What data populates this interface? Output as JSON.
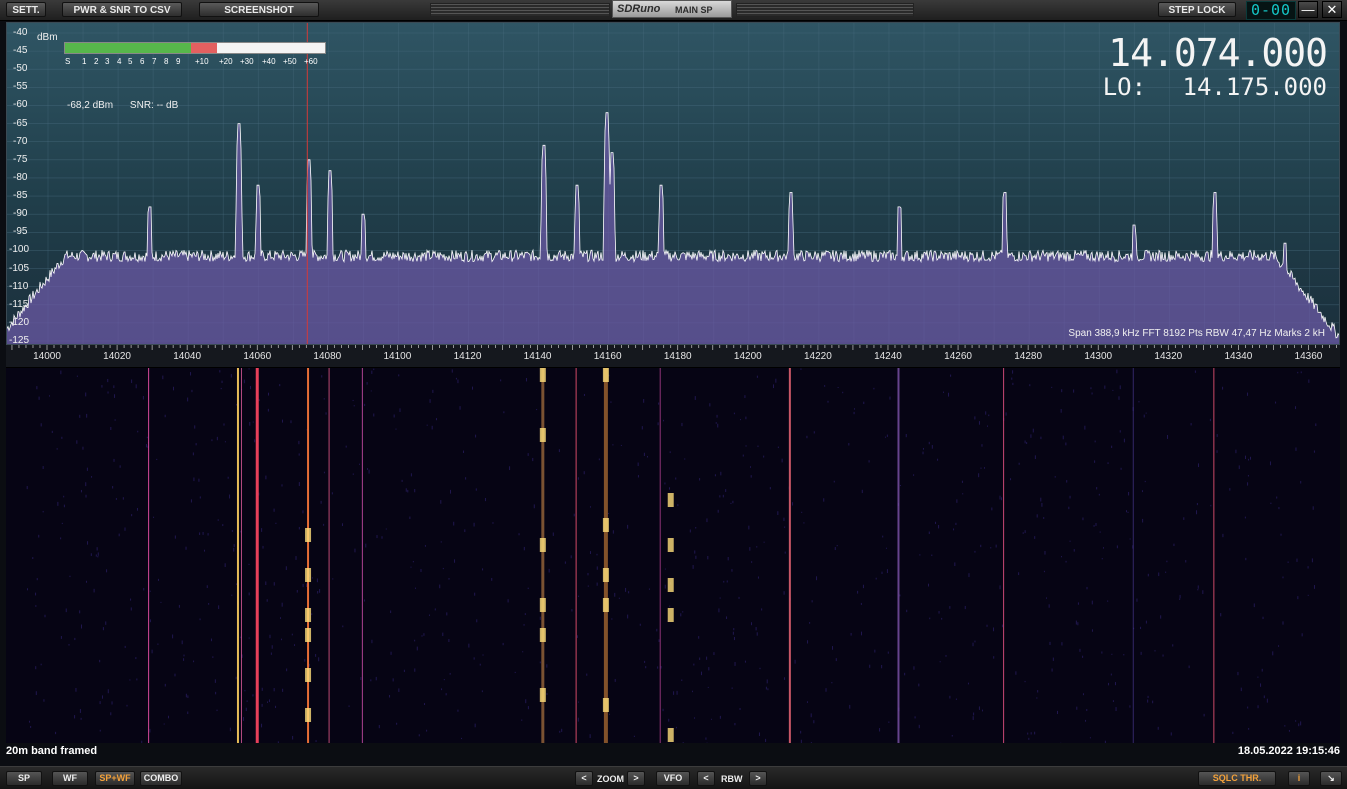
{
  "toolbar": {
    "settings": "SETT.",
    "pwr_snr": "PWR & SNR TO CSV",
    "screenshot": "SCREENSHOT",
    "app_brand": "SDRuno",
    "panel": "MAIN SP",
    "step_lock": "STEP LOCK",
    "digits": "0-00",
    "minimize": "—",
    "close": "✕"
  },
  "spectrum": {
    "unit": "dBm",
    "db_ticks": [
      "-40",
      "-45",
      "-50",
      "-55",
      "-60",
      "-65",
      "-70",
      "-75",
      "-80",
      "-85",
      "-90",
      "-95",
      "-100",
      "-105",
      "-110",
      "-115",
      "-120",
      "-125"
    ],
    "vfo_frequency": "14.074.000",
    "lo_label": "LO:",
    "lo_frequency": "14.175.000",
    "level": "-68,2 dBm",
    "snr": "SNR: -- dB",
    "meter_scale": [
      "S",
      "1",
      "2",
      "3",
      "4",
      "5",
      "6",
      "7",
      "8",
      "9",
      "+10",
      "+20",
      "+30",
      "+40",
      "+50",
      "+60"
    ],
    "info": "Span 388,9 kHz   FFT 8192 Pts   RBW 47,47 Hz   Marks 2 kH",
    "freq_ticks": [
      "14000",
      "14020",
      "14040",
      "14060",
      "14080",
      "14100",
      "14120",
      "14140",
      "14160",
      "14180",
      "14200",
      "14220",
      "14240",
      "14260",
      "14280",
      "14300",
      "14320",
      "14340",
      "14360"
    ],
    "colors": {
      "trace": "#ffffff",
      "fill": "#6b5aa6",
      "marker": "#d23a3a",
      "meter_green": "#57b74b",
      "meter_red": "#e36060"
    }
  },
  "waterfall": {
    "label": "20m band framed",
    "timestamp": "18.05.2022 19:15:46"
  },
  "bottom": {
    "sp": "SP",
    "wf": "WF",
    "spwf": "SP+WF",
    "combo": "COMBO",
    "prev": "<",
    "zoom": "ZOOM",
    "next": ">",
    "vfo": "VFO",
    "rbw_prev": "<",
    "rbw": "RBW",
    "rbw_next": ">",
    "sqlc": "SQLC THR.",
    "info": "i",
    "resize": "↘"
  }
}
